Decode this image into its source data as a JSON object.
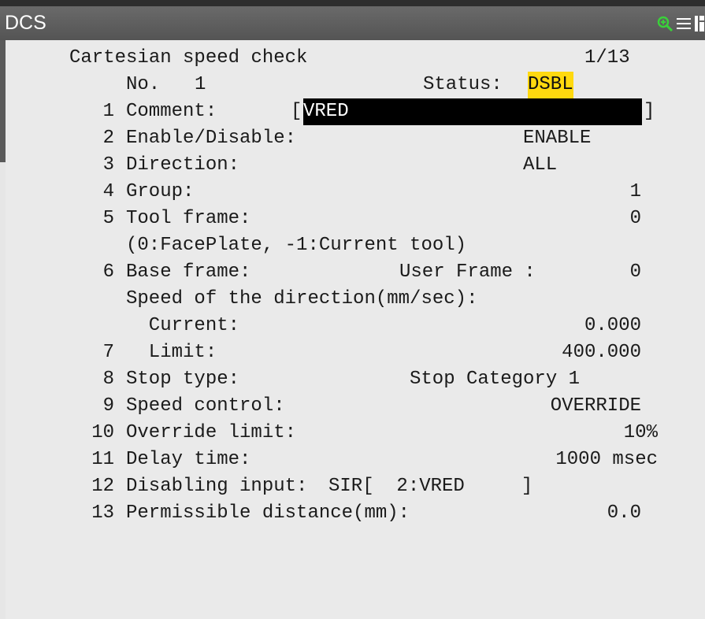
{
  "window": {
    "title": "DCS",
    "icons": [
      "zoom-in-icon",
      "menu-icon",
      "split-screen-icon"
    ]
  },
  "screen": {
    "heading": "Cartesian speed check",
    "page": "1/13",
    "no_label": "No.",
    "no_value": "1",
    "status_label": "Status:",
    "status_value": "DSBL",
    "rows": [
      {
        "num": "1",
        "label": "Comment:",
        "bracket_open": "[",
        "value": "VRED",
        "bracket_close": "]"
      },
      {
        "num": "2",
        "label": "Enable/Disable:",
        "value": "ENABLE"
      },
      {
        "num": "3",
        "label": "Direction:",
        "value": "ALL"
      },
      {
        "num": "4",
        "label": "Group:",
        "value": "1"
      },
      {
        "num": "5",
        "label": "Tool frame:",
        "value": "0"
      },
      {
        "num": "",
        "label": "(0:FacePlate, -1:Current tool)"
      },
      {
        "num": "6",
        "label": "Base frame:",
        "mid": "User Frame :",
        "value": "0"
      },
      {
        "num": "",
        "label": "Speed of the direction(mm/sec):"
      },
      {
        "num": "",
        "label": "  Current:",
        "value": "0.000"
      },
      {
        "num": "7",
        "label": "  Limit:",
        "value": "400.000"
      },
      {
        "num": "8",
        "label": "Stop type:",
        "value": "Stop Category 1"
      },
      {
        "num": "9",
        "label": "Speed control:",
        "value": "OVERRIDE"
      },
      {
        "num": "10",
        "label": "Override limit:",
        "value": "10%"
      },
      {
        "num": "11",
        "label": "Delay time:",
        "value": "1000 msec"
      },
      {
        "num": "12",
        "label": "Disabling input:",
        "value": "SIR[  2:VRED     ]"
      },
      {
        "num": "13",
        "label": "Permissible distance(mm):",
        "value": "0.0"
      }
    ]
  }
}
